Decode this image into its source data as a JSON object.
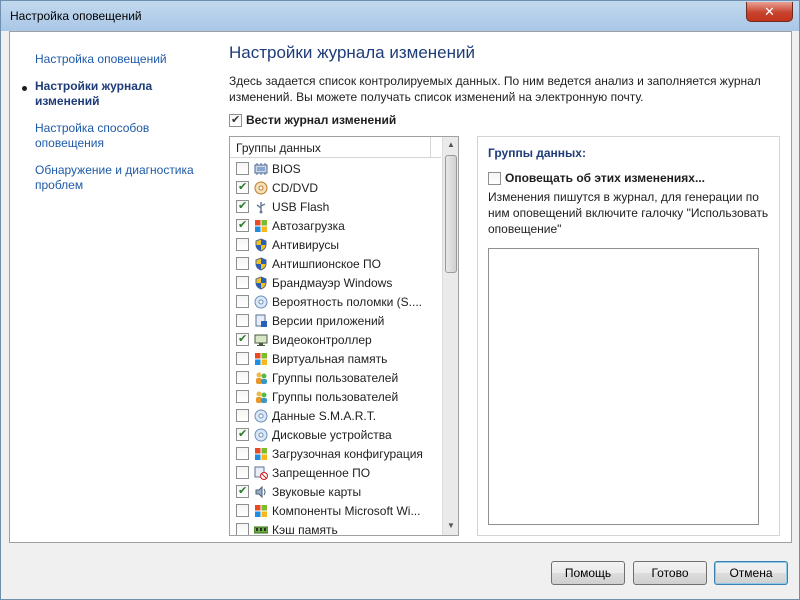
{
  "window": {
    "title": "Настройка оповещений",
    "close_glyph": "✕"
  },
  "nav": {
    "items": [
      {
        "label": "Настройка оповещений",
        "active": false
      },
      {
        "label": "Настройки журнала изменений",
        "active": true
      },
      {
        "label": "Настройка способов оповещения",
        "active": false
      },
      {
        "label": "Обнаружение и диагностика проблем",
        "active": false
      }
    ]
  },
  "main": {
    "heading": "Настройки журнала изменений",
    "description": "Здесь задается список контролируемых данных. По ним ведется анализ и заполняется журнал изменений. Вы можете получать список изменений на электронную почту.",
    "log_checkbox_label": "Вести журнал изменений",
    "log_checked": true
  },
  "list": {
    "header": "Группы данных",
    "rows": [
      {
        "label": "BIOS",
        "checked": false,
        "icon": "chip-icon"
      },
      {
        "label": "CD/DVD",
        "checked": true,
        "icon": "disc-icon"
      },
      {
        "label": "USB Flash",
        "checked": true,
        "icon": "usb-icon"
      },
      {
        "label": "Автозагрузка",
        "checked": true,
        "icon": "windows-icon"
      },
      {
        "label": "Антивирусы",
        "checked": false,
        "icon": "shield-icon"
      },
      {
        "label": "Антишпионское ПО",
        "checked": false,
        "icon": "shield-icon"
      },
      {
        "label": "Брандмауэр Windows",
        "checked": false,
        "icon": "shield-icon"
      },
      {
        "label": "Вероятность поломки (S....",
        "checked": false,
        "icon": "disc-blue-icon"
      },
      {
        "label": "Версии приложений",
        "checked": false,
        "icon": "app-version-icon"
      },
      {
        "label": "Видеоконтроллер",
        "checked": true,
        "icon": "monitor-icon"
      },
      {
        "label": "Виртуальная память",
        "checked": false,
        "icon": "windows-icon"
      },
      {
        "label": "Группы пользователей",
        "checked": false,
        "icon": "users-icon"
      },
      {
        "label": "Группы пользователей",
        "checked": false,
        "icon": "users-icon"
      },
      {
        "label": "Данные S.M.A.R.T.",
        "checked": false,
        "icon": "disc-blue-icon"
      },
      {
        "label": "Дисковые устройства",
        "checked": true,
        "icon": "disc-blue-icon"
      },
      {
        "label": "Загрузочная конфигурация",
        "checked": false,
        "icon": "windows-icon"
      },
      {
        "label": "Запрещенное ПО",
        "checked": false,
        "icon": "forbidden-app-icon"
      },
      {
        "label": "Звуковые карты",
        "checked": true,
        "icon": "speaker-icon"
      },
      {
        "label": "Компоненты Microsoft Wi...",
        "checked": false,
        "icon": "windows-icon"
      },
      {
        "label": "Кэш память",
        "checked": false,
        "icon": "memory-icon"
      }
    ]
  },
  "groups": {
    "title": "Группы данных:",
    "notify_label": "Оповещать об этих изменениях...",
    "notify_checked": false,
    "hint": "Изменения пишутся в журнал, для генерации по ним оповещений включите галочку \"Использовать оповещение\""
  },
  "footer": {
    "help_label": "Помощь",
    "ok_label": "Готово",
    "cancel_label": "Отмена"
  }
}
